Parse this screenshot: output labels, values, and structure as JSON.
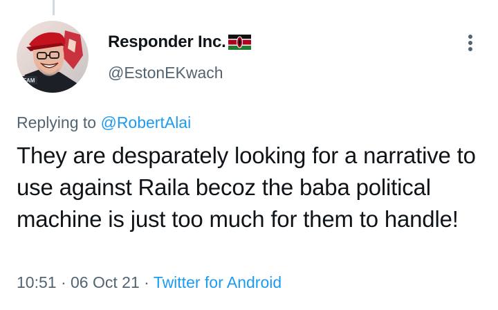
{
  "tweet": {
    "author": {
      "display_name": "Responder Inc.",
      "handle": "@EstonEKwach",
      "avatar_badge": "FAM",
      "flag": "kenya-flag"
    },
    "replying_label": "Replying to",
    "replying_to": "@RobertAlai",
    "text": "They are desparately looking for a narrative to use against Raila becoz the baba political machine is just too much for them to handle!",
    "time": "10:51",
    "date": "06 Oct 21",
    "separator": "·",
    "source": "Twitter for Android"
  },
  "colors": {
    "text_primary": "#0f1419",
    "text_secondary": "#536471",
    "link": "#1d9bf0",
    "thread_line": "#cfd9de"
  }
}
